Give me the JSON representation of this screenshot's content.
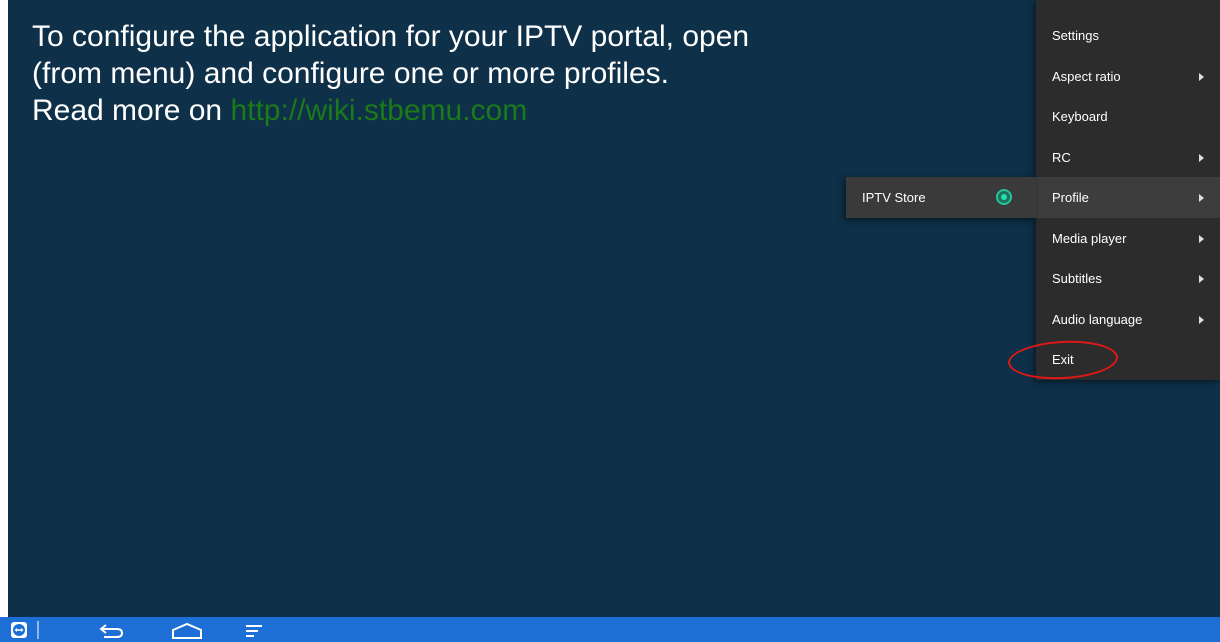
{
  "message": {
    "line1": "To configure the application for your IPTV portal, open",
    "line2": "(from menu) and configure one or more profiles.",
    "line3_prefix": "Read more on ",
    "link": "http://wiki.stbemu.com"
  },
  "menu": {
    "items": [
      {
        "label": "Settings",
        "has_submenu": false
      },
      {
        "label": "Aspect ratio",
        "has_submenu": true
      },
      {
        "label": "Keyboard",
        "has_submenu": false
      },
      {
        "label": "RC",
        "has_submenu": true
      },
      {
        "label": "Profile",
        "has_submenu": true,
        "active": true
      },
      {
        "label": "Media player",
        "has_submenu": true
      },
      {
        "label": "Subtitles",
        "has_submenu": true
      },
      {
        "label": "Audio language",
        "has_submenu": true
      },
      {
        "label": "Exit",
        "has_submenu": false
      }
    ]
  },
  "submenu": {
    "items": [
      {
        "label": "IPTV Store",
        "selected": true
      }
    ]
  },
  "annotation": {
    "color": "#e01818"
  },
  "navbar": {
    "icons": [
      "teamviewer-icon",
      "back-icon",
      "home-icon",
      "menu-icon"
    ],
    "color": "#1d6fd6"
  },
  "colors": {
    "screen_background": "#0e3048",
    "link": "#1a7a1a",
    "menu_background": "#2c2c2c",
    "radio_accent": "#24c29a"
  }
}
